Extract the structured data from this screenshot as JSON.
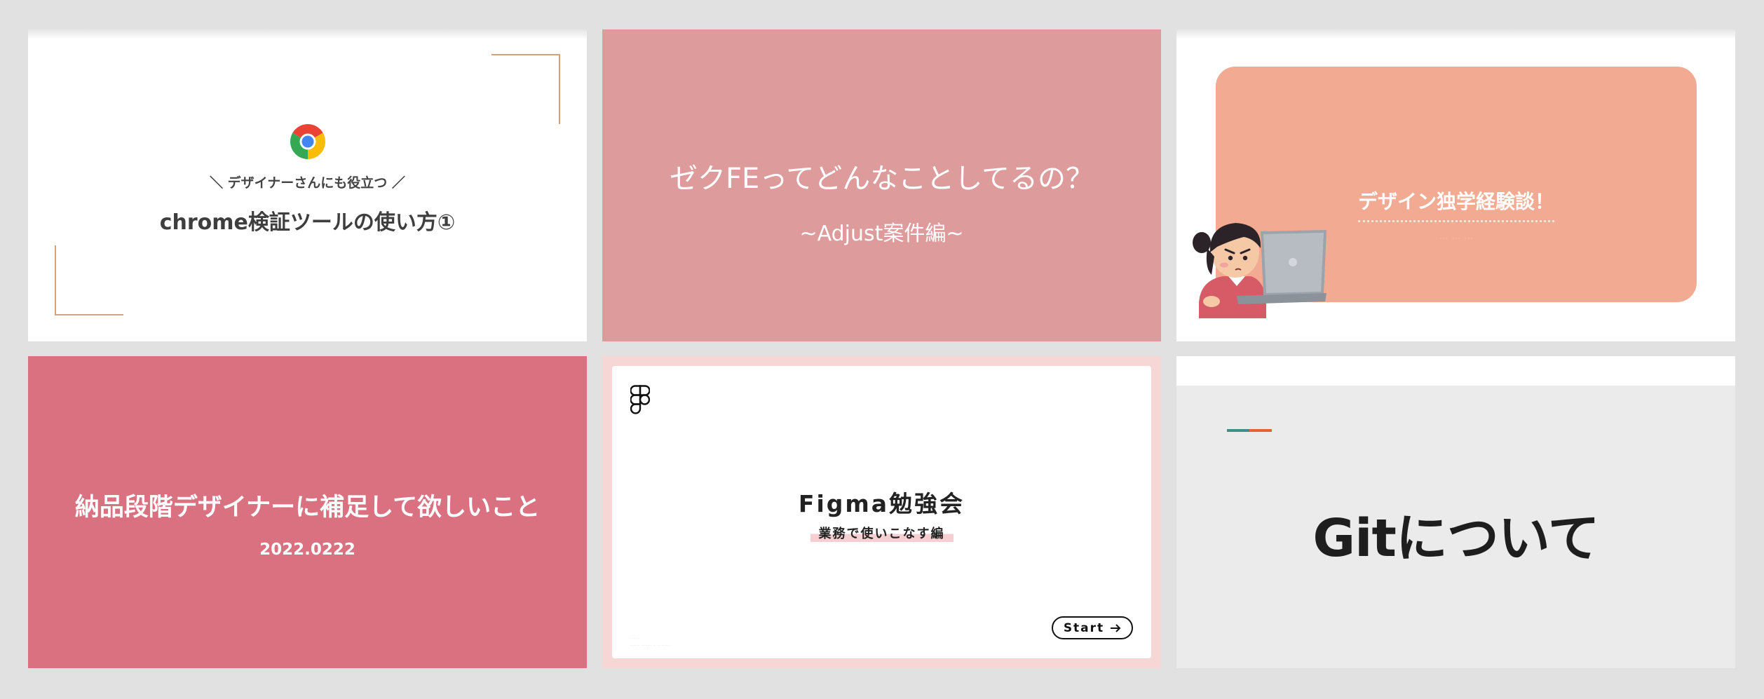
{
  "slides": [
    {
      "subtitle": "＼ デザイナーさんにも役立つ ／",
      "title": "chrome検証ツールの使い方①",
      "logo_icon": "chrome-icon",
      "accent_color": "#d7a07a"
    },
    {
      "title": "ゼクFEってどんなことしてるの？",
      "subtitle": "~Adjust案件編~",
      "background_color": "#de9b9b"
    },
    {
      "title": "デザイン独学経験談！",
      "panel_color": "#f2ab92",
      "illustration_icon": "girl-with-laptop-illustration"
    },
    {
      "title": "納品段階デザイナーに補足して欲しいこと",
      "date": "2022.0222",
      "background_color": "#da7180"
    },
    {
      "title": "Figma勉強会",
      "subtitle": "業務で使いこなす編",
      "start_label": "Start",
      "logo_icon": "figma-icon",
      "frame_color": "#f7d6d6"
    },
    {
      "title": "Gitについて",
      "accent_colors": [
        "#3f8f86",
        "#e5603b"
      ],
      "background_color": "#ebebeb"
    }
  ]
}
